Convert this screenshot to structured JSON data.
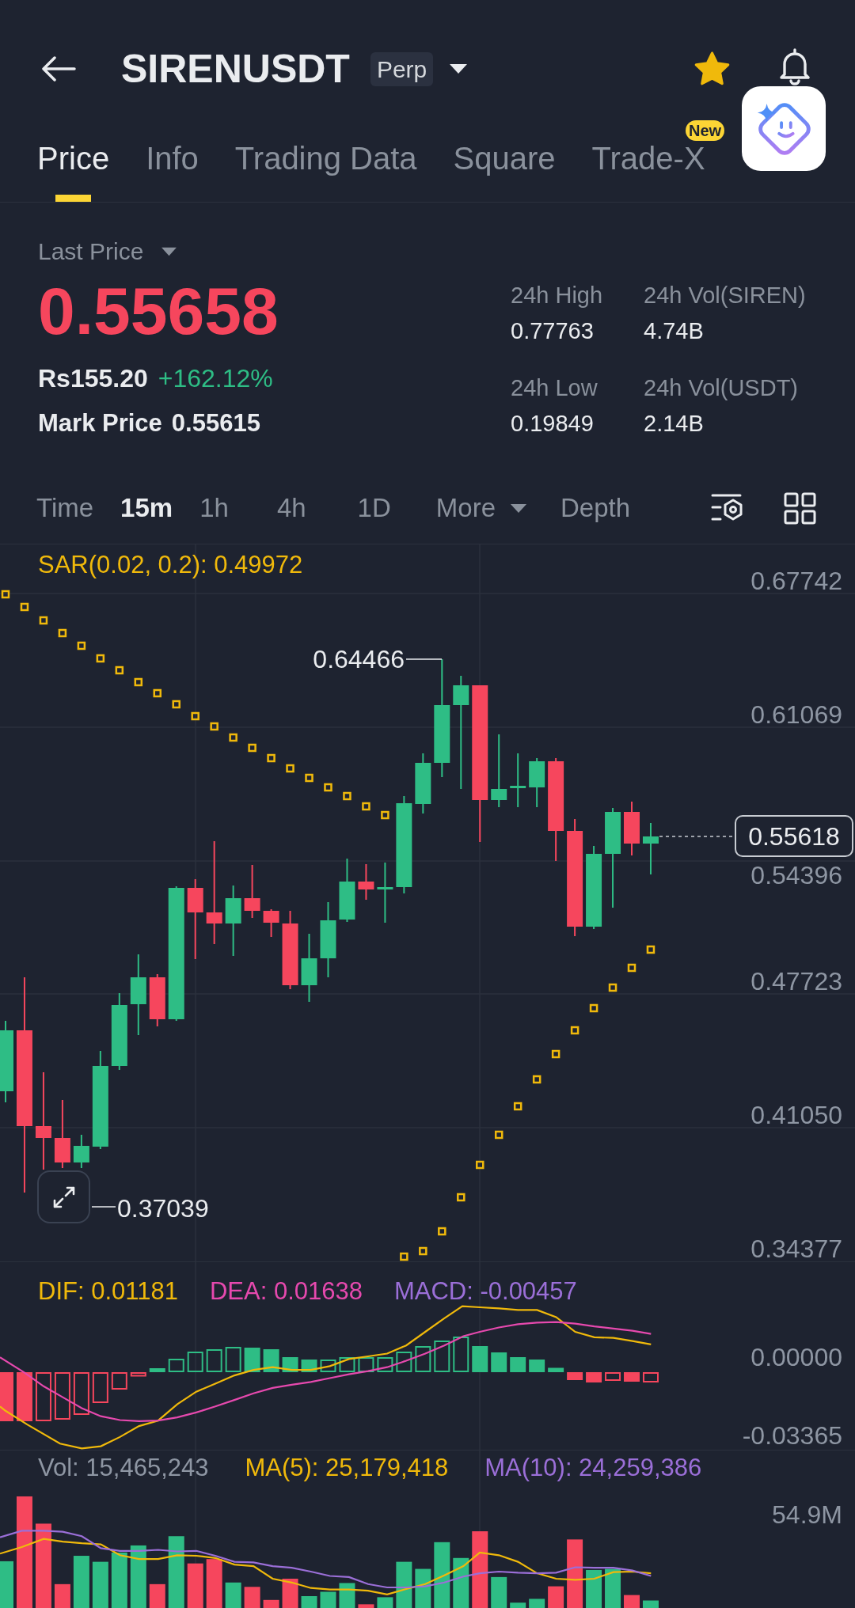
{
  "header": {
    "title": "SIRENUSDT",
    "tag": "Perp",
    "favorite": true
  },
  "tabs": [
    {
      "label": "Price",
      "selected": true
    },
    {
      "label": "Info",
      "selected": false
    },
    {
      "label": "Trading Data",
      "selected": false
    },
    {
      "label": "Square",
      "selected": false
    },
    {
      "label": "Trade-X",
      "selected": false,
      "badge": "New"
    }
  ],
  "ticker": {
    "price_type": "Last Price",
    "last_price": "0.55658",
    "last_price_falling": true,
    "fiat_price": "Rs155.20",
    "change": "+162.12%",
    "change_rising": true,
    "mark_price_label": "Mark Price",
    "mark_price": "0.55615"
  },
  "stats": [
    {
      "label": "24h High",
      "value": "0.77763"
    },
    {
      "label": "24h Vol(SIREN)",
      "value": "4.74B"
    },
    {
      "label": "24h Low",
      "value": "0.19849"
    },
    {
      "label": "24h Vol(USDT)",
      "value": "2.14B"
    }
  ],
  "intervals": [
    {
      "label": "Time",
      "kind": "option",
      "selected": false
    },
    {
      "label": "15m",
      "kind": "option",
      "selected": true
    },
    {
      "label": "1h",
      "kind": "option",
      "selected": false
    },
    {
      "label": "4h",
      "kind": "option",
      "selected": false
    },
    {
      "label": "1D",
      "kind": "option",
      "selected": false
    },
    {
      "label": "More",
      "kind": "dropdown",
      "selected": false
    },
    {
      "label": "Depth",
      "kind": "option",
      "selected": false
    }
  ],
  "price_chart": {
    "indicator": "SAR(0.02, 0.2): 0.49972",
    "price_axis": [
      "0.67742",
      "0.61069",
      "0.54396",
      "0.47723",
      "0.41050",
      "0.34377"
    ],
    "high_label": "0.64466",
    "low_label": "0.37039",
    "last_price_tag": "0.55618"
  },
  "macd": {
    "legend": [
      {
        "text": "DIF: 0.01181",
        "color": "#f0b90b"
      },
      {
        "text": "DEA: 0.01638",
        "color": "#e649ae"
      },
      {
        "text": "MACD: -0.00457",
        "color": "#9b6fd8"
      }
    ],
    "axis": [
      "0.00000",
      "-0.03365"
    ]
  },
  "volume": {
    "legend": [
      {
        "text": "Vol: 15,465,243",
        "color": "#8e96a3"
      },
      {
        "text": "MA(5): 25,179,418",
        "color": "#f0b90b"
      },
      {
        "text": "MA(10): 24,259,386",
        "color": "#9b6fd8"
      }
    ],
    "axis": [
      "54.9M"
    ]
  }
}
